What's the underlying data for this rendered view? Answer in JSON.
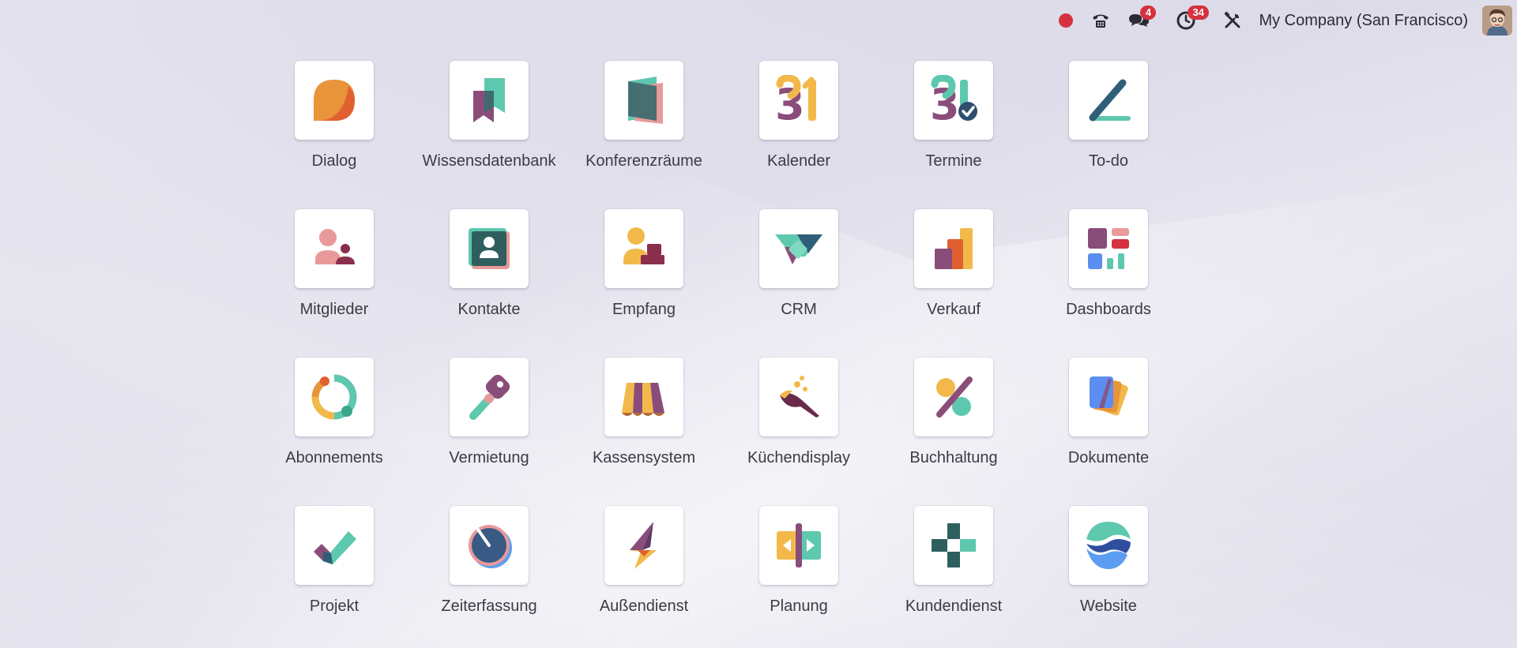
{
  "topbar": {
    "messages_badge": "4",
    "activity_badge": "34",
    "company": "My Company (San Francisco)"
  },
  "apps": [
    {
      "label": "Dialog",
      "icon": "dialog-icon"
    },
    {
      "label": "Wissensdatenbank",
      "icon": "knowledge-icon"
    },
    {
      "label": "Konferenzräume",
      "icon": "room-icon"
    },
    {
      "label": "Kalender",
      "icon": "calendar-icon"
    },
    {
      "label": "Termine",
      "icon": "appointment-icon"
    },
    {
      "label": "To-do",
      "icon": "todo-icon"
    },
    {
      "label": "Mitglieder",
      "icon": "members-icon"
    },
    {
      "label": "Kontakte",
      "icon": "contacts-icon"
    },
    {
      "label": "Empfang",
      "icon": "frontdesk-icon"
    },
    {
      "label": "CRM",
      "icon": "crm-icon"
    },
    {
      "label": "Verkauf",
      "icon": "sales-icon"
    },
    {
      "label": "Dashboards",
      "icon": "dashboards-icon"
    },
    {
      "label": "Abonnements",
      "icon": "subscriptions-icon"
    },
    {
      "label": "Vermietung",
      "icon": "rental-icon"
    },
    {
      "label": "Kassensystem",
      "icon": "pos-icon"
    },
    {
      "label": "Küchendisplay",
      "icon": "kitchen-icon"
    },
    {
      "label": "Buchhaltung",
      "icon": "accounting-icon"
    },
    {
      "label": "Dokumente",
      "icon": "documents-icon"
    },
    {
      "label": "Projekt",
      "icon": "project-icon"
    },
    {
      "label": "Zeiterfassung",
      "icon": "timesheet-icon"
    },
    {
      "label": "Außendienst",
      "icon": "fieldservice-icon"
    },
    {
      "label": "Planung",
      "icon": "planning-icon"
    },
    {
      "label": "Kundendienst",
      "icon": "helpdesk-icon"
    },
    {
      "label": "Website",
      "icon": "website-icon"
    }
  ]
}
